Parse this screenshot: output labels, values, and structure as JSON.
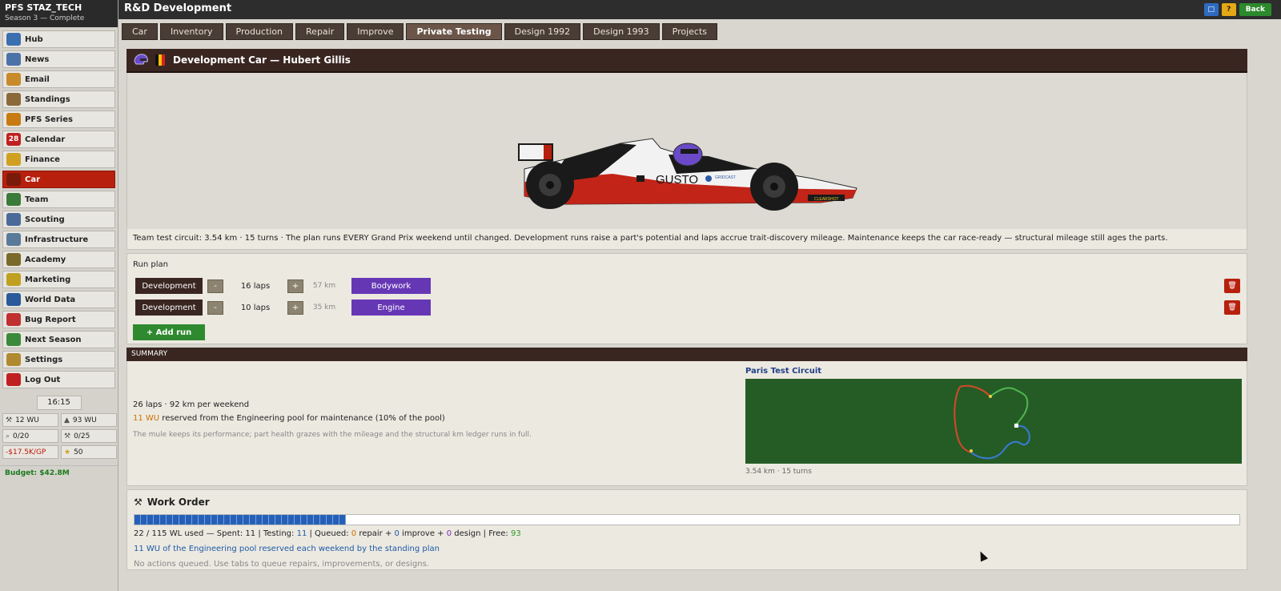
{
  "sidebar": {
    "brand_title": "PFS STAZ_TECH",
    "brand_subtitle": "Season 3 — Complete",
    "items": [
      {
        "label": "Hub",
        "icon": "globe-icon",
        "color": "#3a6fb0"
      },
      {
        "label": "News",
        "icon": "newspaper-icon",
        "color": "#4c73a8"
      },
      {
        "label": "Email",
        "icon": "envelope-icon",
        "color": "#c88a2a"
      },
      {
        "label": "Standings",
        "icon": "clipboard-icon",
        "color": "#8a6a3a"
      },
      {
        "label": "PFS Series",
        "icon": "trophy-icon",
        "color": "#c77a12"
      },
      {
        "label": "Calendar",
        "icon": "calendar-icon",
        "color": "#c02020",
        "glyph": "28"
      },
      {
        "label": "Finance",
        "icon": "money-icon",
        "color": "#d0a020"
      },
      {
        "label": "Car",
        "icon": "race-car-icon",
        "color": "#7a1a0a",
        "active": true
      },
      {
        "label": "Team",
        "icon": "team-icon",
        "color": "#3a7a3a"
      },
      {
        "label": "Scouting",
        "icon": "magnifier-icon",
        "color": "#4a6a9a"
      },
      {
        "label": "Infrastructure",
        "icon": "factory-icon",
        "color": "#5a7a9a"
      },
      {
        "label": "Academy",
        "icon": "academy-icon",
        "color": "#7a6a2a"
      },
      {
        "label": "Marketing",
        "icon": "megaphone-icon",
        "color": "#c0a020"
      },
      {
        "label": "World Data",
        "icon": "world-icon",
        "color": "#2a5a9a"
      },
      {
        "label": "Bug Report",
        "icon": "lifebuoy-icon",
        "color": "#c03030"
      },
      {
        "label": "Next Season",
        "icon": "fast-forward-icon",
        "color": "#3a8a3a"
      },
      {
        "label": "Settings",
        "icon": "gear-icon",
        "color": "#b08a30"
      },
      {
        "label": "Log Out",
        "icon": "power-icon",
        "color": "#c02020"
      }
    ],
    "clock": "16:15",
    "stats": [
      {
        "label": "12 WU",
        "icon": "wrench-icon"
      },
      {
        "label": "93 WU",
        "icon": "flask-icon"
      },
      {
        "label": "0/20",
        "icon": "search-icon"
      },
      {
        "label": "0/25",
        "icon": "tools-icon"
      },
      {
        "label": "-$17.5K/GP",
        "icon": "",
        "red": true
      },
      {
        "label": "50",
        "icon": "star-icon"
      }
    ],
    "budget": "Budget: $42.8M"
  },
  "topbar": {
    "title": "R&D Development",
    "back_label": "Back"
  },
  "tabs": [
    {
      "label": "Car"
    },
    {
      "label": "Inventory"
    },
    {
      "label": "Production"
    },
    {
      "label": "Repair"
    },
    {
      "label": "Improve"
    },
    {
      "label": "Private Testing",
      "active": true
    },
    {
      "label": "Design 1992"
    },
    {
      "label": "Design 1993"
    },
    {
      "label": "Projects"
    }
  ],
  "car_panel": {
    "title": "Development Car — Hubert Gillis",
    "flag_colors": [
      "#111111",
      "#f2c300",
      "#d82020"
    ],
    "livery_sponsor": "GUSTO",
    "livery_small_1": "GRIDCAST",
    "livery_small_2": "CLEARSHOT",
    "description": "Team test circuit: 3.54 km · 15 turns · The plan runs EVERY Grand Prix weekend until changed. Development runs raise a part's potential and laps accrue trait-discovery mileage. Maintenance keeps the car race-ready — structural mileage still ages the parts."
  },
  "run_plan": {
    "label": "Run plan",
    "rows": [
      {
        "type": "Development",
        "minus": "-",
        "laps": "16 laps",
        "plus": "+",
        "km": "57 km",
        "part": "Bodywork"
      },
      {
        "type": "Development",
        "minus": "-",
        "laps": "10 laps",
        "plus": "+",
        "km": "35 km",
        "part": "Engine"
      }
    ],
    "add_label": "+ Add run"
  },
  "summary": {
    "header": "SUMMARY",
    "line1": "26 laps · 92 km  per weekend",
    "line2_num": "11 WU",
    "line2_text": " reserved from the Engineering pool for maintenance (10% of the pool)",
    "line3": "The mule keeps its performance; part health grazes with the mileage and the structural km ledger runs in full.",
    "circuit_title": "Paris Test Circuit",
    "circuit_sub": "3.54 km · 15 turns"
  },
  "work_order": {
    "title": "Work Order",
    "progress": 0.191,
    "usage_prefix": "22  / 115 WL used — Spent: 11 | Testing: ",
    "testing": "11",
    "queued_label": " | Queued: ",
    "queued_repair": "0",
    "repair_label": " repair + ",
    "queued_improve": "0",
    "improve_label": " improve + ",
    "queued_design": "0",
    "design_label": " design | Free: ",
    "free": "93",
    "reserved_num": "11",
    "reserved_text": "  WU of the Engineering pool reserved each weekend by the standing plan",
    "empty_note": "No actions queued. Use tabs to queue repairs, improvements, or designs."
  }
}
